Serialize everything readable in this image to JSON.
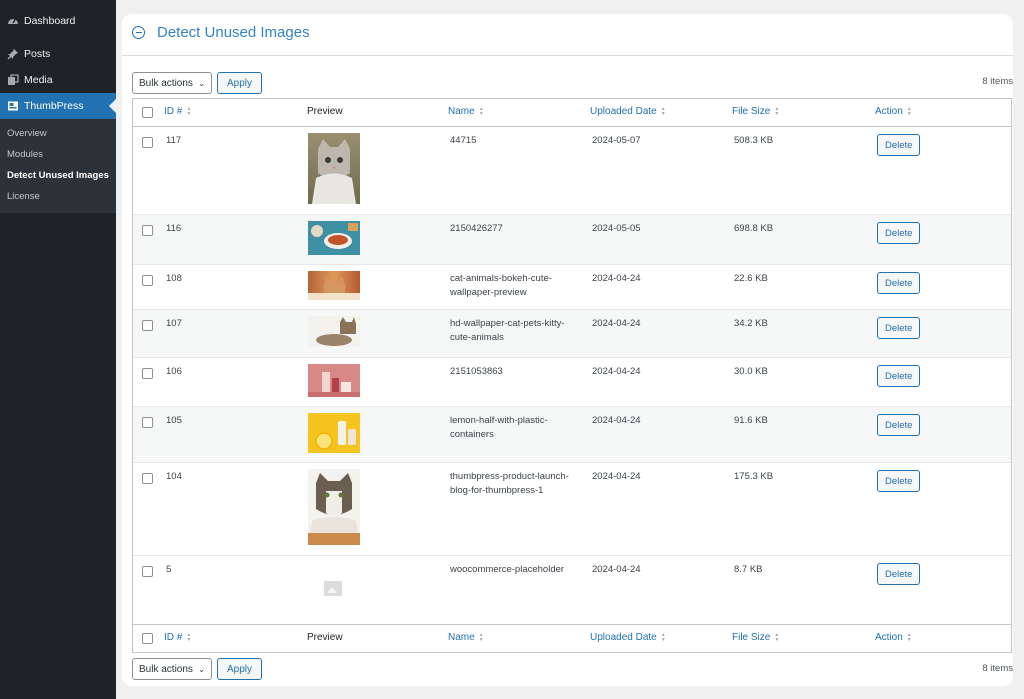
{
  "sidebar": {
    "items": [
      {
        "label": "Dashboard",
        "icon": "dashboard-icon"
      },
      {
        "label": "Posts",
        "icon": "pin-icon"
      },
      {
        "label": "Media",
        "icon": "media-icon"
      },
      {
        "label": "ThumbPress",
        "icon": "thumbpress-icon",
        "active": true
      }
    ],
    "submenu": [
      "Overview",
      "Modules",
      "Detect Unused Images",
      "License"
    ],
    "current_sub": "Detect Unused Images"
  },
  "panel": {
    "title": "Detect Unused Images"
  },
  "tablenav": {
    "bulk_label": "Bulk actions",
    "apply_label": "Apply",
    "count": "8 items"
  },
  "columns": {
    "id": "ID #",
    "preview": "Preview",
    "name": "Name",
    "date": "Uploaded Date",
    "size": "File Size",
    "action": "Action"
  },
  "rows": [
    {
      "id": "117",
      "name": [
        "44715"
      ],
      "date": "2024-05-07",
      "size": "508.3 KB",
      "action": "Delete",
      "preview": "cat-photo"
    },
    {
      "id": "116",
      "name": [
        "2150426277"
      ],
      "date": "2024-05-05",
      "size": "698.8 KB",
      "action": "Delete",
      "preview": "food-photo"
    },
    {
      "id": "108",
      "name": [
        "cat-animals-bokeh-cute-",
        "wallpaper-preview"
      ],
      "date": "2024-04-24",
      "size": "22.6 KB",
      "action": "Delete",
      "preview": "cat-photo"
    },
    {
      "id": "107",
      "name": [
        "hd-wallpaper-cat-pets-kitty-",
        "cute-animals"
      ],
      "date": "2024-04-24",
      "size": "34.2 KB",
      "action": "Delete",
      "preview": "cat-photo"
    },
    {
      "id": "106",
      "name": [
        "2151053863"
      ],
      "date": "2024-04-24",
      "size": "30.0 KB",
      "action": "Delete",
      "preview": "cosmetics-photo"
    },
    {
      "id": "105",
      "name": [
        "lemon-half-with-plastic-",
        "containers"
      ],
      "date": "2024-04-24",
      "size": "91.6 KB",
      "action": "Delete",
      "preview": "lemon-photo"
    },
    {
      "id": "104",
      "name": [
        "thumbpress-product-launch-",
        "blog-for-thumbpress-1"
      ],
      "date": "2024-04-24",
      "size": "175.3 KB",
      "action": "Delete",
      "preview": "cat-photo"
    },
    {
      "id": "5",
      "name": [
        "woocommerce-placeholder"
      ],
      "date": "2024-04-24",
      "size": "8.7 KB",
      "action": "Delete",
      "preview": "placeholder-image"
    }
  ]
}
